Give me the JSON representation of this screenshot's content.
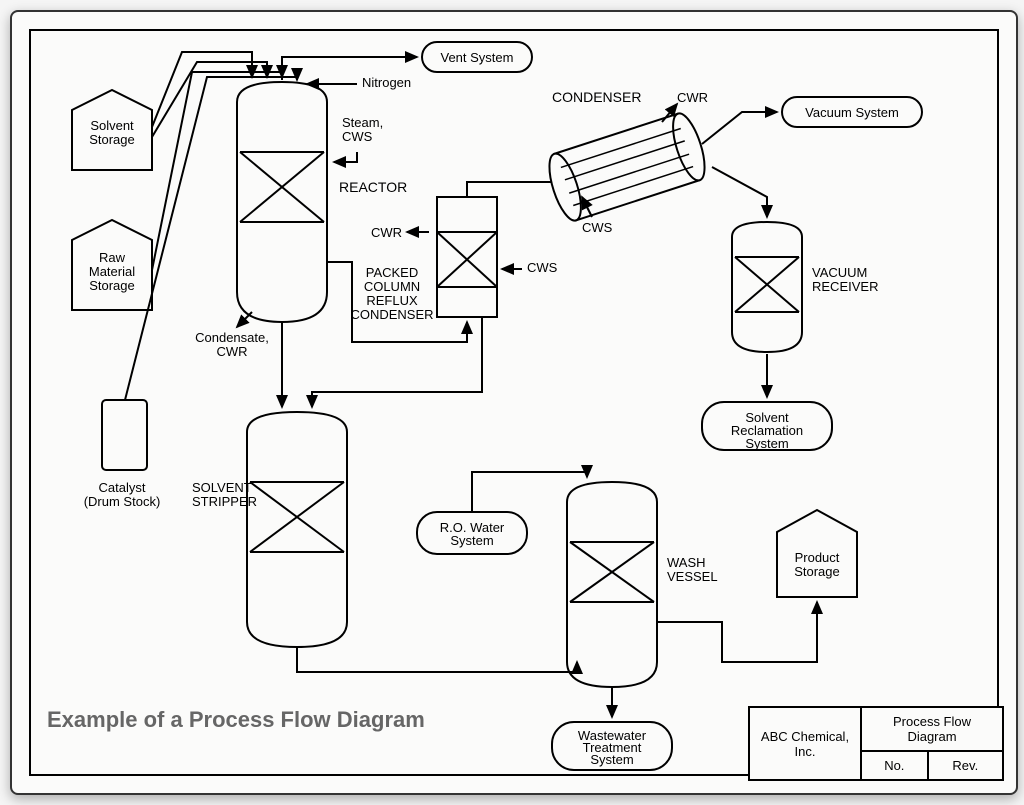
{
  "caption": "Example of a Process Flow Diagram",
  "title_block": {
    "company": "ABC Chemical, Inc.",
    "title": "Process Flow Diagram",
    "no_label": "No.",
    "rev_label": "Rev."
  },
  "labels": {
    "solvent_storage": "Solvent Storage",
    "raw_material_storage": "Raw Material Storage",
    "catalyst": "Catalyst (Drum Stock)",
    "vent_system": "Vent System",
    "nitrogen": "Nitrogen",
    "steam_cws": "Steam, CWS",
    "reactor": "REACTOR",
    "condensate_cwr": "Condensate, CWR",
    "cwr": "CWR",
    "cws": "CWS",
    "packed_column": "PACKED COLUMN REFLUX CONDENSER",
    "condenser": "CONDENSER",
    "vacuum_system": "Vacuum System",
    "vacuum_receiver": "VACUUM RECEIVER",
    "solvent_reclamation": "Solvent Reclamation System",
    "solvent_stripper": "SOLVENT STRIPPER",
    "ro_water": "R.O. Water System",
    "wash_vessel": "WASH VESSEL",
    "product_storage": "Product Storage",
    "wastewater": "Wastewater Treatment System"
  }
}
